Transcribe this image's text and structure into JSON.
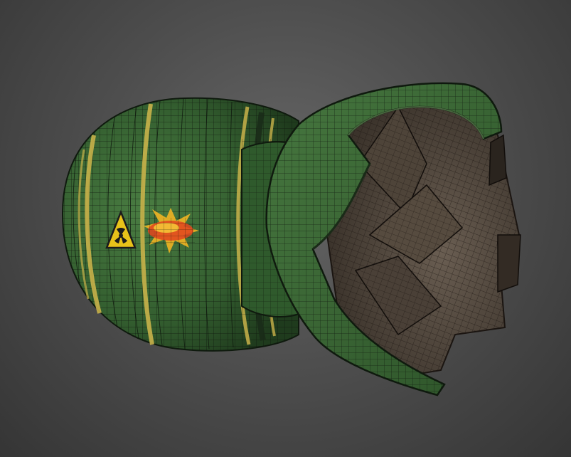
{
  "scene": {
    "subject": "mini-nuke-wireframe-model",
    "background_color": "#4e4e4e",
    "shell_color": "#3f6e3a",
    "shell_dark": "#284a26",
    "stripe_color": "#c9b24a",
    "interior_color": "#5a5046",
    "wire_color": "#111a10",
    "decals": [
      {
        "icon": "radiation-warning-icon",
        "color": "#e8c21a"
      },
      {
        "icon": "explosion-graffiti-icon",
        "color": "#e3451f"
      }
    ]
  }
}
